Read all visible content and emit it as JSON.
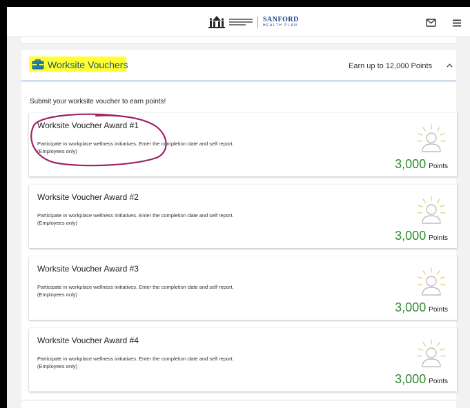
{
  "header": {
    "logo_brand": "SANFORD",
    "logo_sub": "HEALTH PLAN",
    "icons": [
      "logo-mark-icon",
      "mail-icon",
      "menu-icon"
    ]
  },
  "section": {
    "title": "Worksite Vouchers",
    "icon": "briefcase-icon",
    "earn_text": "Earn up to 12,000 Points",
    "toggle_icon": "chevron-up-icon",
    "intro": "Submit your worksite voucher to earn points!"
  },
  "cards": [
    {
      "title": "Worksite Voucher Award #1",
      "desc_line1": "Participate in workplace wellness initiatives. Enter the completion date and self report.",
      "desc_line2": "(Employees only)",
      "points": "3,000",
      "points_unit": "Points",
      "icon": "person-sun-icon"
    },
    {
      "title": "Worksite Voucher Award #2",
      "desc_line1": "Participate in workplace wellness initiatives. Enter the completion date and self report.",
      "desc_line2": "(Employees only)",
      "points": "3,000",
      "points_unit": "Points",
      "icon": "person-sun-icon"
    },
    {
      "title": "Worksite Voucher Award #3",
      "desc_line1": "Participate in workplace wellness initiatives. Enter the completion date and self report.",
      "desc_line2": "(Employees only)",
      "points": "3,000",
      "points_unit": "Points",
      "icon": "person-sun-icon"
    },
    {
      "title": "Worksite Voucher Award #4",
      "desc_line1": "Participate in workplace wellness initiatives. Enter the completion date and self report.",
      "desc_line2": "(Employees only)",
      "points": "3,000",
      "points_unit": "Points",
      "icon": "person-sun-icon"
    }
  ],
  "colors": {
    "title": "#1a5276",
    "points": "#2e8b2e",
    "highlight": "#ffff33",
    "annotation": "#a0226b",
    "divider": "#5b8ec9"
  }
}
